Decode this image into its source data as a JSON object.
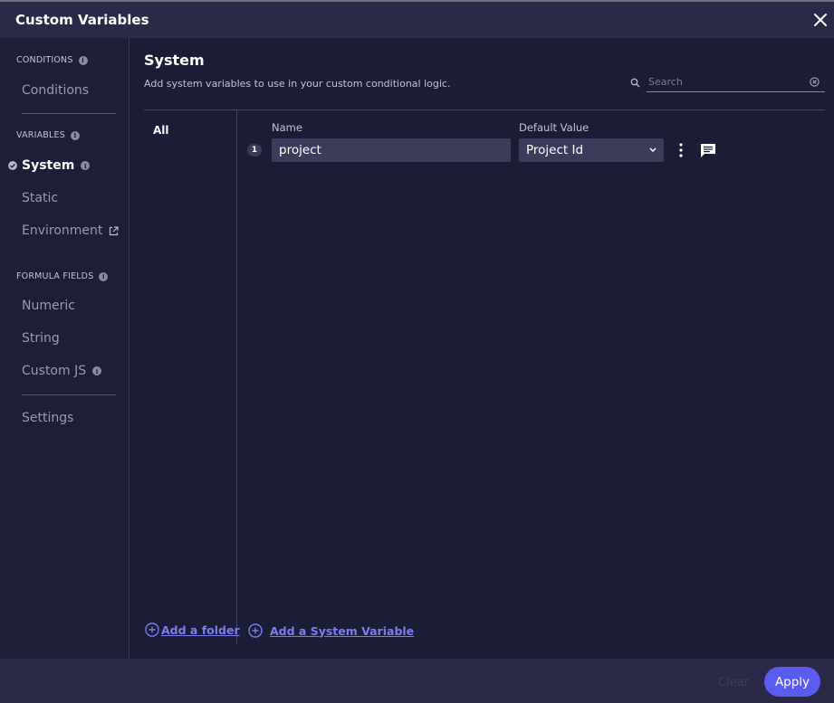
{
  "window": {
    "title": "Custom Variables"
  },
  "sidebar": {
    "sections": [
      {
        "label": "CONDITIONS",
        "items": [
          {
            "label": "Conditions"
          }
        ]
      },
      {
        "label": "VARIABLES",
        "items": [
          {
            "label": "System",
            "active": true
          },
          {
            "label": "Static"
          },
          {
            "label": "Environment"
          }
        ]
      },
      {
        "label": "FORMULA FIELDS",
        "items": [
          {
            "label": "Numeric"
          },
          {
            "label": "String"
          },
          {
            "label": "Custom JS"
          }
        ]
      }
    ],
    "settings_label": "Settings"
  },
  "main": {
    "title": "System",
    "subtitle": "Add system variables to use in your custom conditional logic.",
    "search": {
      "placeholder": "Search",
      "value": ""
    },
    "folders": [
      {
        "label": "All"
      }
    ],
    "columns": {
      "name": "Name",
      "default_value": "Default Value"
    },
    "rows": [
      {
        "index": "1",
        "name": "project",
        "default_value": "Project Id"
      }
    ],
    "add_folder_label": "Add a folder",
    "add_variable_label": "Add a System Variable"
  },
  "footer": {
    "clear_label": "Clear",
    "apply_label": "Apply"
  },
  "colors": {
    "accent": "#5a5cf0",
    "link": "#7b7ef0",
    "background": "#1b1c35",
    "header": "#2a2a48"
  }
}
